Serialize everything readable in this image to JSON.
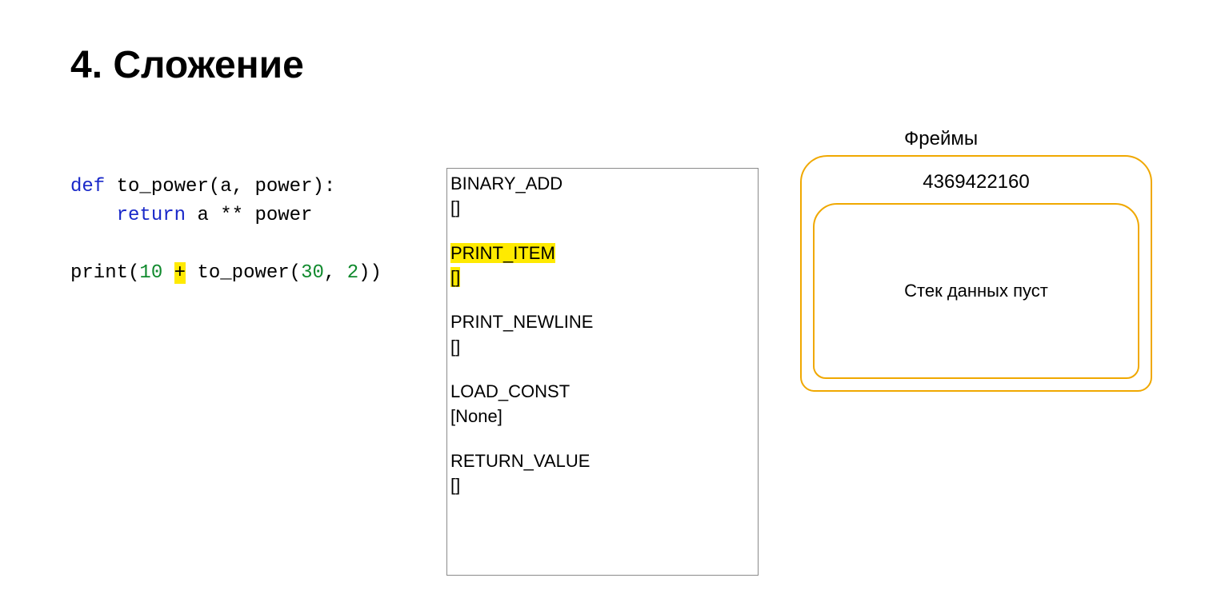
{
  "title": "4. Сложение",
  "code": {
    "def": "def",
    "fn": "to_power",
    "params": "(a, power):",
    "ret": "return",
    "ret_expr": "a ** power",
    "call_prefix": "print(",
    "n1": "10",
    "plus": "+",
    "fn_call": "to_power(",
    "n2": "30",
    "comma": ", ",
    "n3": "2",
    "call_suffix": "))"
  },
  "bytecode": [
    {
      "op": "BINARY_ADD",
      "arg": "[]",
      "hl": false
    },
    {
      "op": "PRINT_ITEM",
      "arg": "[]",
      "hl": true
    },
    {
      "op": "PRINT_NEWLINE",
      "arg": "[]",
      "hl": false
    },
    {
      "op": "LOAD_CONST",
      "arg": "[None]",
      "hl": false
    },
    {
      "op": "RETURN_VALUE",
      "arg": "[]",
      "hl": false
    }
  ],
  "frames": {
    "label": "Фреймы",
    "id": "4369422160",
    "empty": "Стек данных пуст"
  }
}
